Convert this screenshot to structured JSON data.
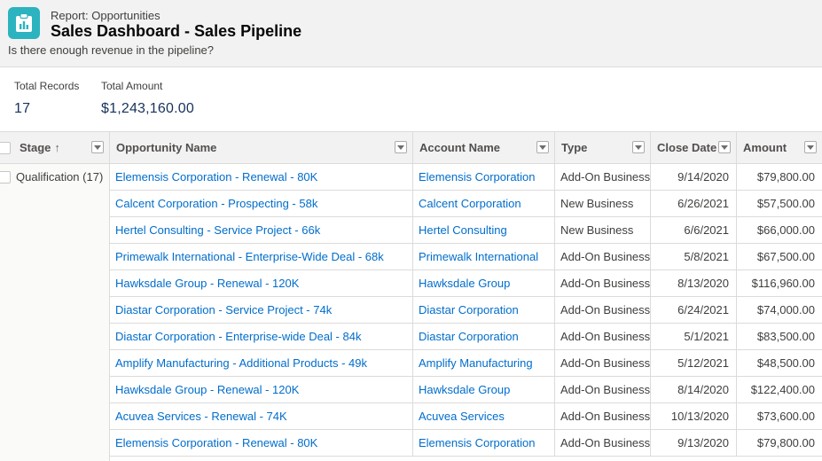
{
  "header": {
    "eyebrow": "Report: Opportunities",
    "title": "Sales Dashboard - Sales Pipeline",
    "subtitle": "Is there enough revenue in the pipeline?"
  },
  "summary": {
    "total_records_label": "Total Records",
    "total_records_value": "17",
    "total_amount_label": "Total Amount",
    "total_amount_value": "$1,243,160.00"
  },
  "columns": {
    "stage": "Stage",
    "stage_sort": "↑",
    "opportunity": "Opportunity Name",
    "account": "Account Name",
    "type": "Type",
    "close_date": "Close Date",
    "amount": "Amount"
  },
  "group": {
    "label": "Qualification (17)"
  },
  "rows": [
    {
      "opportunity": "Elemensis Corporation - Renewal - 80K",
      "account": "Elemensis Corporation",
      "type": "Add-On Business",
      "close_date": "9/14/2020",
      "amount": "$79,800.00"
    },
    {
      "opportunity": "Calcent Corporation - Prospecting - 58k",
      "account": "Calcent Corporation",
      "type": "New Business",
      "close_date": "6/26/2021",
      "amount": "$57,500.00"
    },
    {
      "opportunity": "Hertel Consulting - Service Project - 66k",
      "account": "Hertel Consulting",
      "type": "New Business",
      "close_date": "6/6/2021",
      "amount": "$66,000.00"
    },
    {
      "opportunity": "Primewalk International - Enterprise-Wide Deal - 68k",
      "account": "Primewalk International",
      "type": "Add-On Business",
      "close_date": "5/8/2021",
      "amount": "$67,500.00"
    },
    {
      "opportunity": "Hawksdale Group - Renewal - 120K",
      "account": "Hawksdale Group",
      "type": "Add-On Business",
      "close_date": "8/13/2020",
      "amount": "$116,960.00"
    },
    {
      "opportunity": "Diastar Corporation - Service Project - 74k",
      "account": "Diastar Corporation",
      "type": "Add-On Business",
      "close_date": "6/24/2021",
      "amount": "$74,000.00"
    },
    {
      "opportunity": "Diastar Corporation - Enterprise-wide Deal - 84k",
      "account": "Diastar Corporation",
      "type": "Add-On Business",
      "close_date": "5/1/2021",
      "amount": "$83,500.00"
    },
    {
      "opportunity": "Amplify Manufacturing - Additional Products - 49k",
      "account": "Amplify Manufacturing",
      "type": "Add-On Business",
      "close_date": "5/12/2021",
      "amount": "$48,500.00"
    },
    {
      "opportunity": "Hawksdale Group - Renewal - 120K",
      "account": "Hawksdale Group",
      "type": "Add-On Business",
      "close_date": "8/14/2020",
      "amount": "$122,400.00"
    },
    {
      "opportunity": "Acuvea Services - Renewal - 74K",
      "account": "Acuvea Services",
      "type": "Add-On Business",
      "close_date": "10/13/2020",
      "amount": "$73,600.00"
    },
    {
      "opportunity": "Elemensis Corporation - Renewal - 80K",
      "account": "Elemensis Corporation",
      "type": "Add-On Business",
      "close_date": "9/13/2020",
      "amount": "$79,800.00"
    }
  ]
}
